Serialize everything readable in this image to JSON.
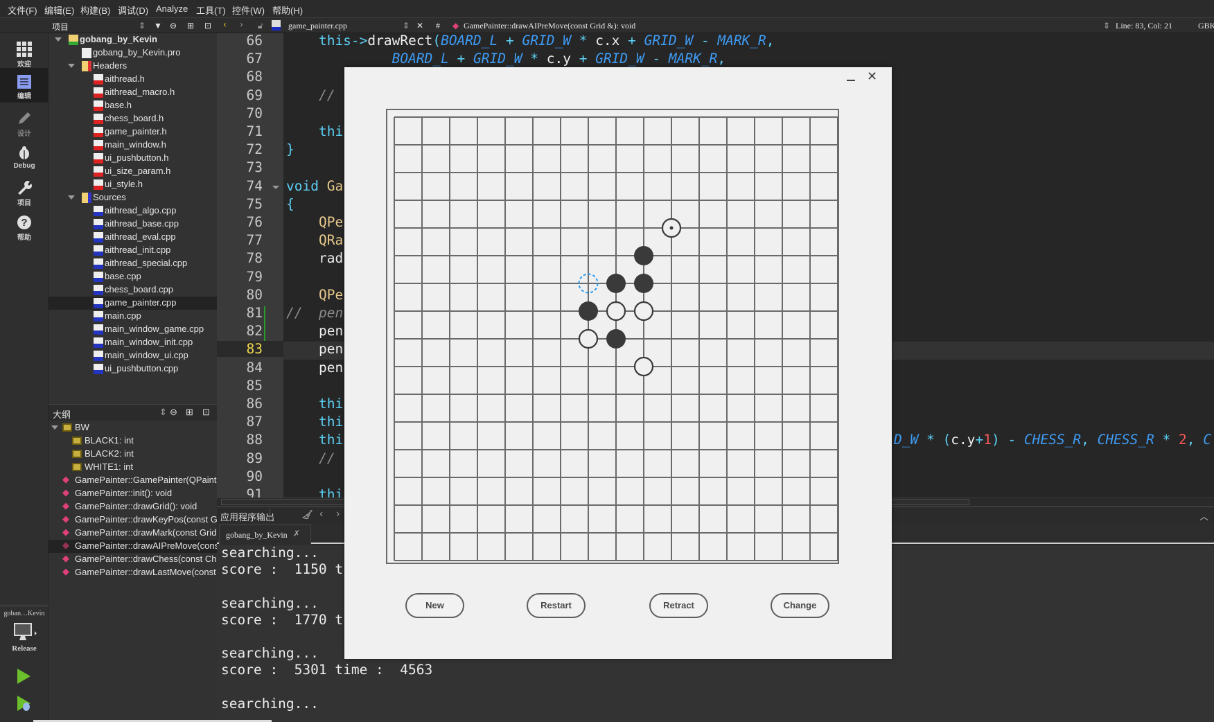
{
  "menu": [
    "文件(F)",
    "编辑(E)",
    "构建(B)",
    "调试(D)",
    "Analyze",
    "工具(T)",
    "控件(W)",
    "帮助(H)"
  ],
  "toolbar": {
    "project_label": "项目",
    "file_name": "game_painter.cpp",
    "hash": "#",
    "symbol": "GamePainter::drawAIPreMove(const Grid &): void",
    "cursor_pos": "Line: 83, Col: 21",
    "encoding": "GBK"
  },
  "modes": [
    {
      "label": "欢迎",
      "icon": "grid-icon"
    },
    {
      "label": "编辑",
      "icon": "edit-icon",
      "selected": true
    },
    {
      "label": "设计",
      "icon": "pencil-icon"
    },
    {
      "label": "Debug",
      "icon": "bug-icon"
    },
    {
      "label": "项目",
      "icon": "wrench-icon"
    },
    {
      "label": "帮助",
      "icon": "help-icon"
    }
  ],
  "kit": {
    "project": "goban…Kevin",
    "config": "Release"
  },
  "tree": {
    "items": [
      {
        "label": "gobang_by_Kevin",
        "level": 0,
        "kind": "project",
        "expanded": true
      },
      {
        "label": "gobang_by_Kevin.pro",
        "level": 1,
        "kind": "pro"
      },
      {
        "label": "Headers",
        "level": 1,
        "kind": "folder-h",
        "expanded": true
      },
      {
        "label": "aithread.h",
        "level": 2,
        "kind": "h"
      },
      {
        "label": "aithread_macro.h",
        "level": 2,
        "kind": "h"
      },
      {
        "label": "base.h",
        "level": 2,
        "kind": "h"
      },
      {
        "label": "chess_board.h",
        "level": 2,
        "kind": "h"
      },
      {
        "label": "game_painter.h",
        "level": 2,
        "kind": "h"
      },
      {
        "label": "main_window.h",
        "level": 2,
        "kind": "h"
      },
      {
        "label": "ui_pushbutton.h",
        "level": 2,
        "kind": "h"
      },
      {
        "label": "ui_size_param.h",
        "level": 2,
        "kind": "h"
      },
      {
        "label": "ui_style.h",
        "level": 2,
        "kind": "h"
      },
      {
        "label": "Sources",
        "level": 1,
        "kind": "folder-cpp",
        "expanded": true
      },
      {
        "label": "aithread_algo.cpp",
        "level": 2,
        "kind": "cpp"
      },
      {
        "label": "aithread_base.cpp",
        "level": 2,
        "kind": "cpp"
      },
      {
        "label": "aithread_eval.cpp",
        "level": 2,
        "kind": "cpp"
      },
      {
        "label": "aithread_init.cpp",
        "level": 2,
        "kind": "cpp"
      },
      {
        "label": "aithread_special.cpp",
        "level": 2,
        "kind": "cpp"
      },
      {
        "label": "base.cpp",
        "level": 2,
        "kind": "cpp"
      },
      {
        "label": "chess_board.cpp",
        "level": 2,
        "kind": "cpp"
      },
      {
        "label": "game_painter.cpp",
        "level": 2,
        "kind": "cpp",
        "selected": true
      },
      {
        "label": "main.cpp",
        "level": 2,
        "kind": "cpp"
      },
      {
        "label": "main_window_game.cpp",
        "level": 2,
        "kind": "cpp"
      },
      {
        "label": "main_window_init.cpp",
        "level": 2,
        "kind": "cpp"
      },
      {
        "label": "main_window_ui.cpp",
        "level": 2,
        "kind": "cpp"
      },
      {
        "label": "ui_pushbutton.cpp",
        "level": 2,
        "kind": "cpp"
      }
    ]
  },
  "outline": {
    "title": "大纲",
    "items": [
      {
        "label": "BW",
        "level": 0,
        "kind": "enum",
        "expanded": true
      },
      {
        "label": "BLACK1: int",
        "level": 1,
        "kind": "enumval"
      },
      {
        "label": "BLACK2: int",
        "level": 1,
        "kind": "enumval"
      },
      {
        "label": "WHITE1: int",
        "level": 1,
        "kind": "enumval"
      },
      {
        "label": "GamePainter::GamePainter(QPaintD",
        "level": 0,
        "kind": "func"
      },
      {
        "label": "GamePainter::init(): void",
        "level": 0,
        "kind": "func"
      },
      {
        "label": "GamePainter::drawGrid(): void",
        "level": 0,
        "kind": "func"
      },
      {
        "label": "GamePainter::drawKeyPos(const G",
        "level": 0,
        "kind": "func"
      },
      {
        "label": "GamePainter::drawMark(const Grid",
        "level": 0,
        "kind": "func"
      },
      {
        "label": "GamePainter::drawAIPreMove(cons",
        "level": 0,
        "kind": "func",
        "selected": true
      },
      {
        "label": "GamePainter::drawChess(const Che",
        "level": 0,
        "kind": "func"
      },
      {
        "label": "GamePainter::drawLastMove(const",
        "level": 0,
        "kind": "func"
      }
    ]
  },
  "editor": {
    "current_line": 83,
    "lines": [
      {
        "n": 66,
        "tokens": [
          {
            "t": "    this",
            "k": "kw"
          },
          {
            "t": "->",
            "k": "op"
          },
          {
            "t": "drawRect",
            "k": "id"
          },
          {
            "t": "(",
            "k": "op"
          },
          {
            "t": "BOARD_L",
            "k": "mac"
          },
          {
            "t": " + ",
            "k": "op"
          },
          {
            "t": "GRID_W",
            "k": "mac"
          },
          {
            "t": " * ",
            "k": "op"
          },
          {
            "t": "c.x",
            "k": "id"
          },
          {
            "t": " + ",
            "k": "op"
          },
          {
            "t": "GRID_W",
            "k": "mac"
          },
          {
            "t": " - ",
            "k": "op"
          },
          {
            "t": "MARK_R",
            "k": "mac"
          },
          {
            "t": ",",
            "k": "op"
          }
        ]
      },
      {
        "n": 67,
        "tokens": [
          {
            "t": "             ",
            "k": "id"
          },
          {
            "t": "BOARD_L",
            "k": "mac"
          },
          {
            "t": " + ",
            "k": "op"
          },
          {
            "t": "GRID_W",
            "k": "mac"
          },
          {
            "t": " * ",
            "k": "op"
          },
          {
            "t": "c.y",
            "k": "id"
          },
          {
            "t": " + ",
            "k": "op"
          },
          {
            "t": "GRID_W",
            "k": "mac"
          },
          {
            "t": " - ",
            "k": "op"
          },
          {
            "t": "MARK_R",
            "k": "mac"
          },
          {
            "t": ",",
            "k": "op"
          }
        ]
      },
      {
        "n": 68,
        "tokens": []
      },
      {
        "n": 69,
        "tokens": [
          {
            "t": "    //",
            "k": "cm"
          }
        ]
      },
      {
        "n": 70,
        "tokens": []
      },
      {
        "n": 71,
        "tokens": [
          {
            "t": "    thi",
            "k": "kw"
          }
        ]
      },
      {
        "n": 72,
        "tokens": [
          {
            "t": "}",
            "k": "op"
          }
        ]
      },
      {
        "n": 73,
        "tokens": []
      },
      {
        "n": 74,
        "tokens": [
          {
            "t": "void",
            "k": "kw"
          },
          {
            "t": " Ga",
            "k": "ty"
          }
        ],
        "fold": true
      },
      {
        "n": 75,
        "tokens": [
          {
            "t": "{",
            "k": "op"
          }
        ]
      },
      {
        "n": 76,
        "tokens": [
          {
            "t": "    QPe",
            "k": "ty"
          }
        ]
      },
      {
        "n": 77,
        "tokens": [
          {
            "t": "    QRa",
            "k": "ty"
          }
        ]
      },
      {
        "n": 78,
        "tokens": [
          {
            "t": "    rad",
            "k": "id"
          }
        ]
      },
      {
        "n": 79,
        "tokens": []
      },
      {
        "n": 80,
        "tokens": [
          {
            "t": "    QPe",
            "k": "ty"
          }
        ]
      },
      {
        "n": 81,
        "tokens": [
          {
            "t": "//  pen",
            "k": "cm"
          }
        ],
        "changed": true
      },
      {
        "n": 82,
        "tokens": [
          {
            "t": "    pen",
            "k": "id"
          }
        ],
        "changed": true
      },
      {
        "n": 83,
        "tokens": [
          {
            "t": "    pen",
            "k": "id"
          }
        ]
      },
      {
        "n": 84,
        "tokens": [
          {
            "t": "    pen",
            "k": "id"
          }
        ]
      },
      {
        "n": 85,
        "tokens": []
      },
      {
        "n": 86,
        "tokens": [
          {
            "t": "    thi",
            "k": "kw"
          }
        ]
      },
      {
        "n": 87,
        "tokens": [
          {
            "t": "    thi",
            "k": "kw"
          }
        ]
      },
      {
        "n": 88,
        "tokens": [
          {
            "t": "    thi",
            "k": "kw"
          }
        ],
        "tail": [
          {
            "t": "D_W",
            "k": "mac"
          },
          {
            "t": " * (",
            "k": "op"
          },
          {
            "t": "c.y",
            "k": "id"
          },
          {
            "t": "+",
            "k": "op"
          },
          {
            "t": "1",
            "k": "num"
          },
          {
            "t": ") - ",
            "k": "op"
          },
          {
            "t": "CHESS_R",
            "k": "mac"
          },
          {
            "t": ", ",
            "k": "op"
          },
          {
            "t": "CHESS_R",
            "k": "mac"
          },
          {
            "t": " * ",
            "k": "op"
          },
          {
            "t": "2",
            "k": "num"
          },
          {
            "t": ", ",
            "k": "op"
          },
          {
            "t": "C",
            "k": "mac"
          }
        ]
      },
      {
        "n": 89,
        "tokens": [
          {
            "t": "    //",
            "k": "cm"
          }
        ]
      },
      {
        "n": 90,
        "tokens": []
      },
      {
        "n": 91,
        "tokens": [
          {
            "t": "    thi",
            "k": "kw"
          }
        ]
      }
    ]
  },
  "output": {
    "title": "应用程序输出",
    "tab": "gobang_by_Kevin",
    "lines": [
      "searching...",
      "score :  1150 t",
      "",
      "searching...",
      "score :  1770 t",
      "",
      "searching...",
      "score :  5301 time :  4563",
      "",
      "searching..."
    ]
  },
  "game": {
    "board_lines": 17,
    "stones": [
      {
        "col": 10,
        "row": 4,
        "color": "white",
        "last_move": true
      },
      {
        "col": 9,
        "row": 5,
        "color": "black"
      },
      {
        "col": 8,
        "row": 6,
        "color": "black"
      },
      {
        "col": 9,
        "row": 6,
        "color": "black"
      },
      {
        "col": 7,
        "row": 6,
        "color": "ai-premove"
      },
      {
        "col": 7,
        "row": 7,
        "color": "black"
      },
      {
        "col": 8,
        "row": 7,
        "color": "white"
      },
      {
        "col": 9,
        "row": 7,
        "color": "white"
      },
      {
        "col": 7,
        "row": 8,
        "color": "white"
      },
      {
        "col": 8,
        "row": 8,
        "color": "black"
      },
      {
        "col": 9,
        "row": 9,
        "color": "white"
      }
    ],
    "colors": {
      "black": "#3a3a3a",
      "white": "#f0f0f0",
      "premove": "#2a9af0",
      "grid": "#6a6a6a"
    },
    "buttons": [
      "New",
      "Restart",
      "Retract",
      "Change"
    ]
  }
}
